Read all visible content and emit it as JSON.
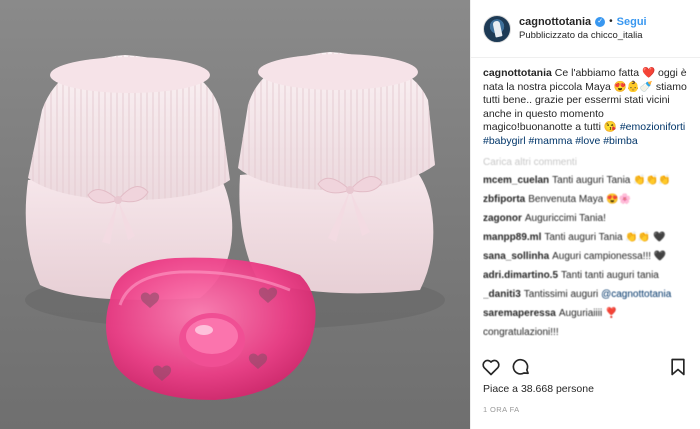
{
  "header": {
    "username": "cagnottotania",
    "verified_badge": "✓",
    "separator": "•",
    "follow_label": "Segui",
    "sponsored_prefix": "Pubblicizzato da",
    "sponsor": "chicco_italia"
  },
  "caption": {
    "username": "cagnottotania",
    "text": "Ce l'abbiamo fatta ❤️ oggi è nata la nostra piccola Maya 😍👶🍼 stiamo tutti bene.. grazie per essermi stati vicini anche in questo momento magico!buonanotte a tutti 😘",
    "hashtags": "#emozioniforti #babygirl #mamma #love #bimba"
  },
  "load_more_label": "Carica altri commenti",
  "comments": [
    {
      "user": "mcem_cuelan",
      "text": "Tanti auguri Tania 👏👏👏"
    },
    {
      "user": "zbfiporta",
      "text": "Benvenuta Maya 😍🌸"
    },
    {
      "user": "zagonor",
      "text": "Auguriccimi Tania!"
    },
    {
      "user": "manpp89.ml",
      "text": "Tanti auguri Tania 👏👏 🖤"
    },
    {
      "user": "sana_sollinha",
      "text": "Auguri campionessa!!! 🖤"
    },
    {
      "user": "adri.dimartino.5",
      "text": "Tanti tanti auguri tania"
    },
    {
      "user": "_daniti3",
      "text": "Tantissimi auguri ",
      "mention": "@cagnottotania"
    },
    {
      "user": "saremaperessa",
      "text": "Auguriaiiii ❣️"
    },
    {
      "user": "",
      "text": "congratulazioni!!!"
    }
  ],
  "actions": {
    "like_icon": "heart-icon",
    "comment_icon": "comment-bubble-icon",
    "save_icon": "bookmark-icon"
  },
  "likes_text": "Piace a 38.668 persone",
  "timestamp": "1 ORA FA",
  "colors": {
    "link": "#3897f0",
    "hashtag": "#003569",
    "pacifier": "#e8307a",
    "bootie": "#f7e6ea",
    "background": "#7d7d7d"
  }
}
